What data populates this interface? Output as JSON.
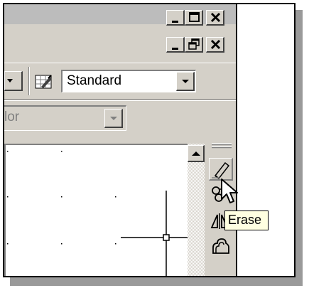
{
  "window_buttons": {
    "app": [
      "minimize-icon",
      "maximize-icon",
      "close-icon"
    ],
    "document": [
      "minimize-icon",
      "restore-icon",
      "close-icon"
    ]
  },
  "toolbar": {
    "text_style_value": "Standard",
    "color_value": "lor"
  },
  "modify_toolbar": {
    "tools": [
      "erase-icon",
      "copy-icon",
      "mirror-icon",
      "offset-icon"
    ]
  },
  "tooltip": {
    "text": "Erase"
  },
  "colors": {
    "face": "#d4d0c8",
    "tooltip_bg": "#ffffe1",
    "disabled_text": "#808080"
  }
}
